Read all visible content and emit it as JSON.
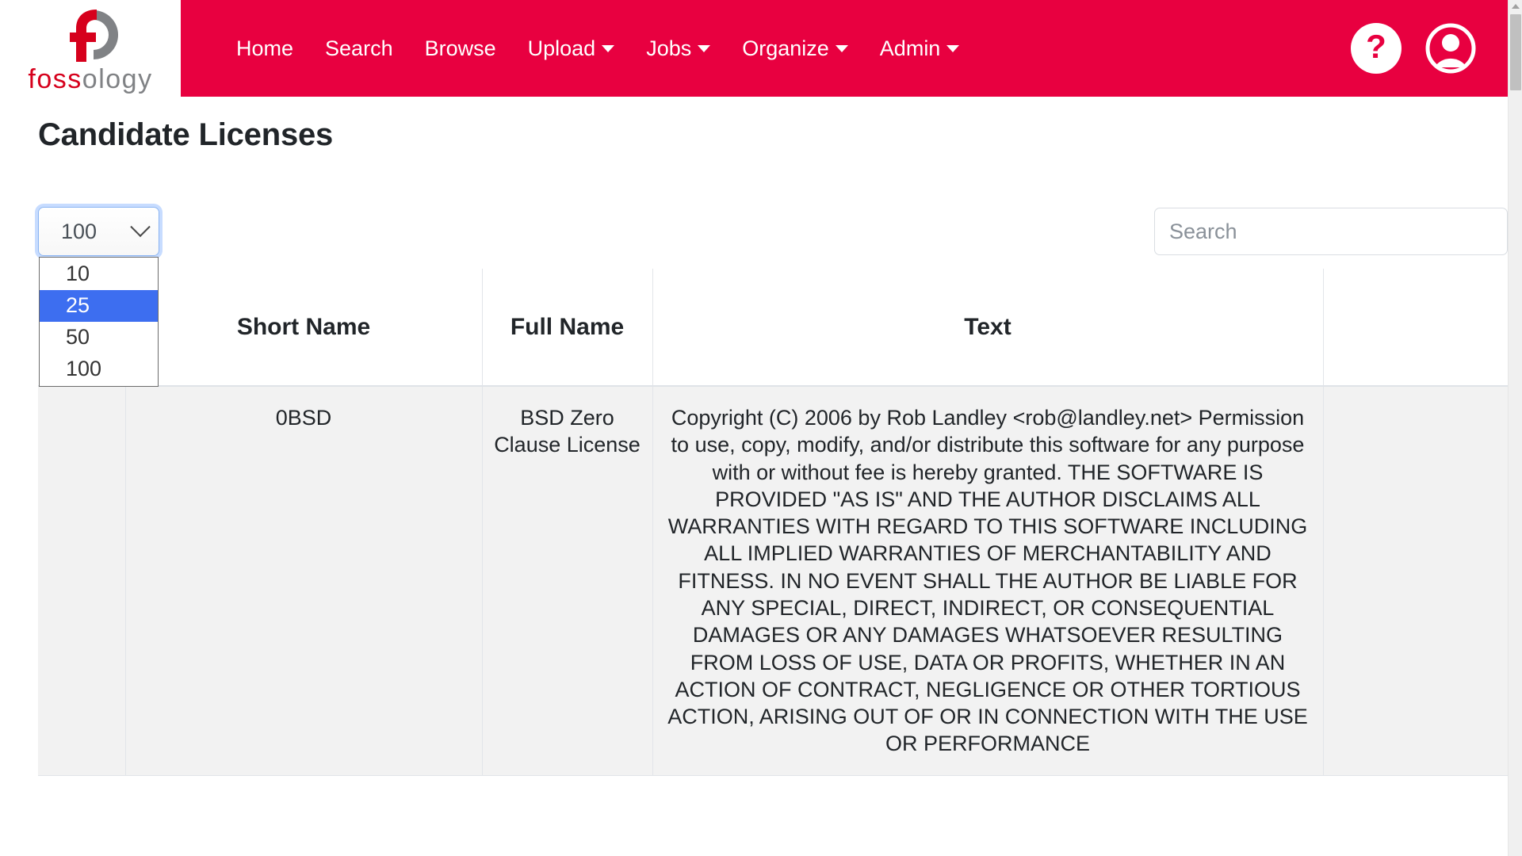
{
  "brand": {
    "word_part1": "foss",
    "word_part2": "ology",
    "logo_icon": "fossology-f-circle-logo"
  },
  "navbar": {
    "background_color": "#E80040",
    "items": [
      {
        "label": "Home",
        "has_dropdown": false
      },
      {
        "label": "Search",
        "has_dropdown": false
      },
      {
        "label": "Browse",
        "has_dropdown": false
      },
      {
        "label": "Upload",
        "has_dropdown": true
      },
      {
        "label": "Jobs",
        "has_dropdown": true
      },
      {
        "label": "Organize",
        "has_dropdown": true
      },
      {
        "label": "Admin",
        "has_dropdown": true
      }
    ],
    "help_icon": "question-mark-circle-icon",
    "help_glyph": "?",
    "user_icon": "user-account-circle-icon"
  },
  "page": {
    "title": "Candidate Licenses"
  },
  "controls": {
    "page_length": {
      "selected": "100",
      "options": [
        "10",
        "25",
        "50",
        "100"
      ],
      "highlighted_option": "25",
      "highlight_color": "#3D6EF0",
      "expanded": true
    },
    "search": {
      "value": "",
      "placeholder": "Search"
    }
  },
  "table": {
    "columns": [
      "",
      "Short Name",
      "Full Name",
      "Text",
      ""
    ],
    "rows": [
      {
        "checkbox": "",
        "short_name": "0BSD",
        "full_name": "BSD Zero Clause License",
        "text": "Copyright (C) 2006 by Rob Landley <rob@landley.net> Permission to use, copy, modify, and/or distribute this software for any purpose with or without fee is hereby granted. THE SOFTWARE IS PROVIDED \"AS IS\" AND THE AUTHOR DISCLAIMS ALL WARRANTIES WITH REGARD TO THIS SOFTWARE INCLUDING ALL IMPLIED WARRANTIES OF MERCHANTABILITY AND FITNESS. IN NO EVENT SHALL THE AUTHOR BE LIABLE FOR ANY SPECIAL, DIRECT, INDIRECT, OR CONSEQUENTIAL DAMAGES OR ANY DAMAGES WHATSOEVER RESULTING FROM LOSS OF USE, DATA OR PROFITS, WHETHER IN AN ACTION OF CONTRACT, NEGLIGENCE OR OTHER TORTIOUS ACTION, ARISING OUT OF OR IN CONNECTION WITH THE USE OR PERFORMANCE",
        "last": ""
      }
    ]
  }
}
